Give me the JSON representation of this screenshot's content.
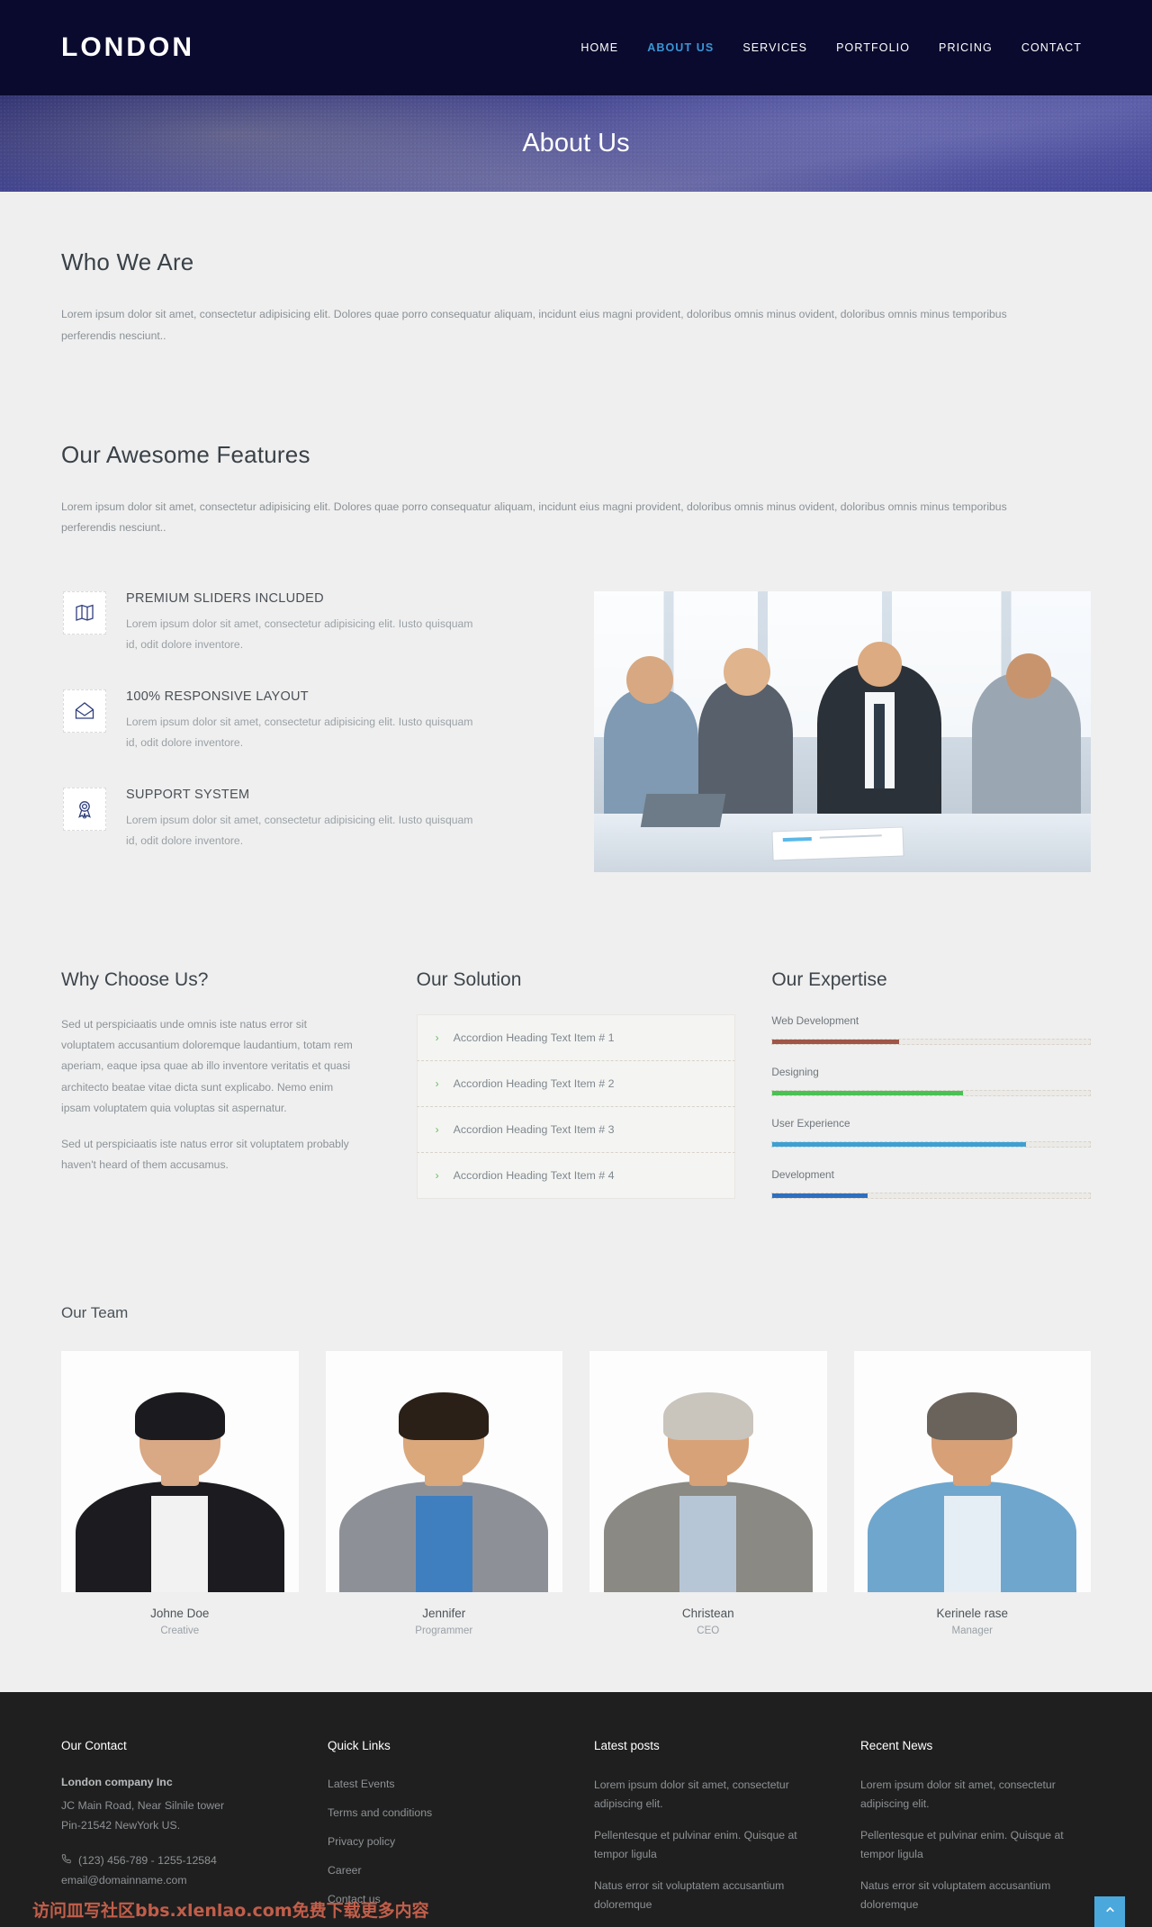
{
  "header": {
    "brand": "LONDON",
    "nav": [
      {
        "label": "HOME",
        "active": false
      },
      {
        "label": "ABOUT US",
        "active": true
      },
      {
        "label": "SERVICES",
        "active": false
      },
      {
        "label": "PORTFOLIO",
        "active": false
      },
      {
        "label": "PRICING",
        "active": false
      },
      {
        "label": "CONTACT",
        "active": false
      }
    ]
  },
  "hero": {
    "title": "About Us"
  },
  "who_we_are": {
    "title": "Who We Are",
    "body": "Lorem ipsum dolor sit amet, consectetur adipisicing elit. Dolores quae porro consequatur aliquam, incidunt eius magni provident, doloribus omnis minus ovident, doloribus omnis minus temporibus perferendis nesciunt.."
  },
  "features": {
    "title": "Our Awesome Features",
    "body": "Lorem ipsum dolor sit amet, consectetur adipisicing elit. Dolores quae porro consequatur aliquam, incidunt eius magni provident, doloribus omnis minus ovident, doloribus omnis minus temporibus perferendis nesciunt..",
    "items": [
      {
        "icon": "map-icon",
        "title": "PREMIUM SLIDERS INCLUDED",
        "text": "Lorem ipsum dolor sit amet, consectetur adipisicing elit. Iusto quisquam id, odit dolore inventore."
      },
      {
        "icon": "envelope-open-icon",
        "title": "100% RESPONSIVE LAYOUT",
        "text": "Lorem ipsum dolor sit amet, consectetur adipisicing elit. Iusto quisquam id, odit dolore inventore."
      },
      {
        "icon": "award-ribbon-icon",
        "title": "SUPPORT SYSTEM",
        "text": "Lorem ipsum dolor sit amet, consectetur adipisicing elit. Iusto quisquam id, odit dolore inventore."
      }
    ]
  },
  "why_choose_us": {
    "title": "Why Choose Us?",
    "paragraph1": "Sed ut perspiciaatis unde omnis iste natus error sit voluptatem accusantium doloremque laudantium, totam rem aperiam, eaque ipsa quae ab illo inventore veritatis et quasi architecto beatae vitae dicta sunt explicabo. Nemo enim ipsam voluptatem quia voluptas sit aspernatur.",
    "paragraph2": "Sed ut perspiciaatis iste natus error sit voluptatem probably haven't heard of them accusamus."
  },
  "our_solution": {
    "title": "Our Solution",
    "items": [
      "Accordion Heading Text Item # 1",
      "Accordion Heading Text Item # 2",
      "Accordion Heading Text Item # 3",
      "Accordion Heading Text Item # 4"
    ],
    "chevron": "›"
  },
  "our_expertise": {
    "title": "Our Expertise",
    "bars": [
      {
        "label": "Web Development",
        "percent": 40,
        "color": "#a05647",
        "striped": false
      },
      {
        "label": "Designing",
        "percent": 60,
        "color": "#49c253",
        "striped": false
      },
      {
        "label": "User Experience",
        "percent": 80,
        "color": "#3da0d4",
        "striped": true
      },
      {
        "label": "Development",
        "percent": 30,
        "color": "#2f6fbf",
        "striped": true
      }
    ]
  },
  "team": {
    "title": "Our Team",
    "members": [
      {
        "name": "Johne Doe",
        "role": "Creative",
        "hair": "#1b1b1f",
        "skin": "#d9a884",
        "outfit": "#1c1c20",
        "inner": "#f2f2f2"
      },
      {
        "name": "Jennifer",
        "role": "Programmer",
        "hair": "#2a2018",
        "skin": "#dba87c",
        "outfit": "#8d9197",
        "inner": "#3f7fc0"
      },
      {
        "name": "Christean",
        "role": "CEO",
        "hair": "#c9c4bc",
        "skin": "#d8a278",
        "outfit": "#8b8983",
        "inner": "#b7c6d6"
      },
      {
        "name": "Kerinele rase",
        "role": "Manager",
        "hair": "#6a635c",
        "skin": "#d7a077",
        "outfit": "#6fa6cd",
        "inner": "#e6eef5"
      }
    ]
  },
  "footer": {
    "contact": {
      "title": "Our Contact",
      "company": "London company Inc",
      "address_line1": "JC Main Road, Near Silnile tower",
      "address_line2": "Pin-21542 NewYork US.",
      "phone": "(123) 456-789 - 1255-12584",
      "email": "email@domainname.com"
    },
    "quick_links": {
      "title": "Quick Links",
      "items": [
        "Latest Events",
        "Terms and conditions",
        "Privacy policy",
        "Career",
        "Contact us"
      ]
    },
    "latest_posts": {
      "title": "Latest posts",
      "items": [
        "Lorem ipsum dolor sit amet, consectetur adipiscing elit.",
        "Pellentesque et pulvinar enim. Quisque at tempor ligula",
        "Natus error sit voluptatem accusantium doloremque"
      ]
    },
    "recent_news": {
      "title": "Recent News",
      "items": [
        "Lorem ipsum dolor sit amet, consectetur adipiscing elit.",
        "Pellentesque et pulvinar enim. Quisque at tempor ligula",
        "Natus error sit voluptatem accusantium doloremque"
      ]
    },
    "watermark": "访问皿写社区bbs.xlenlao.com免费下载更多内容"
  }
}
